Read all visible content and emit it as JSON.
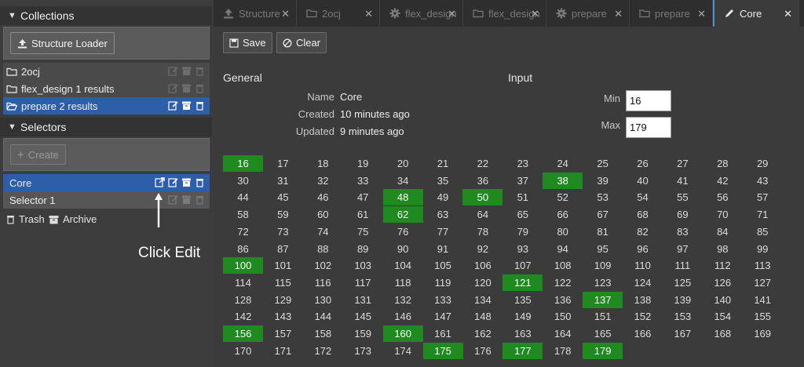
{
  "sidebar": {
    "collections_title": "Collections",
    "structure_loader_label": "Structure Loader",
    "collections": [
      {
        "label": "2ocj",
        "selected": false,
        "icon": "folder-icon"
      },
      {
        "label": "flex_design 1 results",
        "selected": false,
        "icon": "folder-icon"
      },
      {
        "label": "prepare 2 results",
        "selected": true,
        "icon": "folder-open-icon"
      }
    ],
    "selectors_title": "Selectors",
    "create_label": "Create",
    "selectors": [
      {
        "label": "Core",
        "selected": true
      },
      {
        "label": "Selector 1",
        "selected": false
      }
    ],
    "trash_label": "Trash",
    "archive_label": "Archive"
  },
  "annotation": {
    "text": "Click Edit"
  },
  "tabs": [
    {
      "label": "Structure",
      "icon": "upload-icon",
      "active": false
    },
    {
      "label": "2ocj",
      "icon": "folder-icon",
      "active": false
    },
    {
      "label": "flex_design",
      "icon": "gear-icon",
      "active": false
    },
    {
      "label": "flex_design",
      "icon": "folder-icon",
      "active": false
    },
    {
      "label": "prepare",
      "icon": "gear-icon",
      "active": false
    },
    {
      "label": "prepare",
      "icon": "folder-icon",
      "active": false
    },
    {
      "label": "Core",
      "icon": "pencil-icon",
      "active": true
    }
  ],
  "toolbar": {
    "save_label": "Save",
    "clear_label": "Clear"
  },
  "general": {
    "title": "General",
    "name_label": "Name",
    "name_value": "Core",
    "created_label": "Created",
    "created_value": "10 minutes ago",
    "updated_label": "Updated",
    "updated_value": "9 minutes ago"
  },
  "input": {
    "title": "Input",
    "min_label": "Min",
    "min_value": "16",
    "max_label": "Max",
    "max_value": "179"
  },
  "residues": {
    "start": 16,
    "end": 179,
    "columns": 14,
    "selected": [
      16,
      38,
      48,
      50,
      62,
      100,
      121,
      137,
      156,
      160,
      175,
      177,
      179
    ]
  },
  "colors": {
    "selection": "#2d5fa8",
    "highlight": "#1f8a1f",
    "active_tab_accent": "#4a90d9"
  }
}
